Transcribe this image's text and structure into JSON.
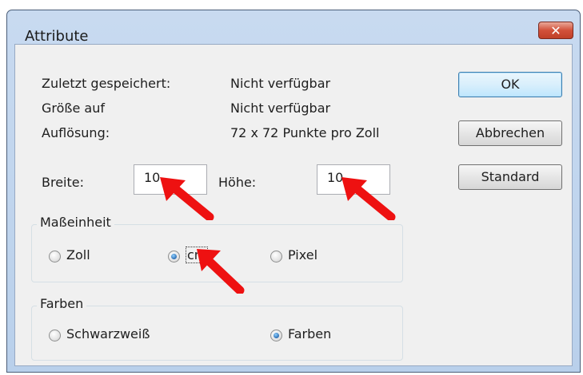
{
  "dialog": {
    "title": "Attribute",
    "close_label": "✕"
  },
  "info": {
    "last_saved_label": "Zuletzt gespeichert:",
    "last_saved_value": "Nicht verfügbar",
    "size_label": "Größe auf",
    "size_value": "Nicht verfügbar",
    "resolution_label": "Auflösung:",
    "resolution_value": "72 x 72 Punkte pro Zoll"
  },
  "buttons": {
    "ok": "OK",
    "cancel": "Abbrechen",
    "default": "Standard"
  },
  "fields": {
    "width_label": "Breite:",
    "width_value": "10",
    "height_label": "Höhe:",
    "height_value": "10"
  },
  "units": {
    "legend": "Maßeinheit",
    "options": [
      "Zoll",
      "cm",
      "Pixel"
    ],
    "selected": "cm"
  },
  "colors": {
    "legend": "Farben",
    "options": [
      "Schwarzweiß",
      "Farben"
    ],
    "selected": "Farben"
  },
  "annotation_color": "#ee1111",
  "icons": [
    "close-icon",
    "red-arrow-icon"
  ]
}
